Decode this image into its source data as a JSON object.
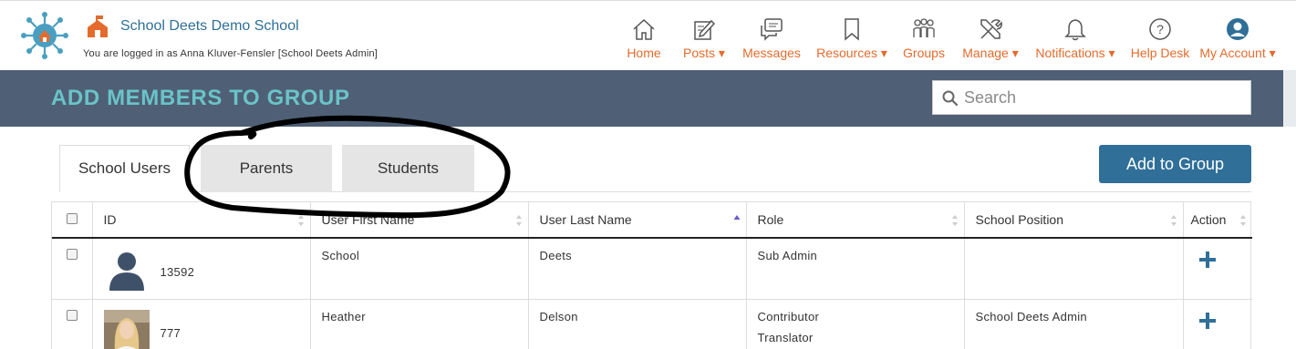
{
  "header": {
    "school_name": "School Deets Demo School",
    "logged_in_text": "You are logged in as Anna Kluver-Fensler [School Deets Admin]"
  },
  "nav": [
    {
      "label": "Home",
      "icon": "home-icon"
    },
    {
      "label": "Posts ▾",
      "icon": "edit-icon"
    },
    {
      "label": "Messages",
      "icon": "chat-icon"
    },
    {
      "label": "Resources ▾",
      "icon": "bookmark-icon"
    },
    {
      "label": "Groups",
      "icon": "people-icon"
    },
    {
      "label": "Manage ▾",
      "icon": "tools-icon"
    },
    {
      "label": "Notifications ▾",
      "icon": "bell-icon"
    },
    {
      "label": "Help Desk",
      "icon": "question-icon"
    },
    {
      "label": "My Account ▾",
      "icon": "user-icon"
    }
  ],
  "page_title": "ADD MEMBERS TO GROUP",
  "search": {
    "placeholder": "Search",
    "value": ""
  },
  "tabs": [
    {
      "label": "School Users",
      "active": true
    },
    {
      "label": "Parents",
      "active": false
    },
    {
      "label": "Students",
      "active": false
    }
  ],
  "add_button_label": "Add to Group",
  "table": {
    "columns": [
      "ID",
      "User First Name",
      "User Last Name",
      "Role",
      "School Position",
      "Action"
    ],
    "rows": [
      {
        "id": "13592",
        "first": "School",
        "last": "Deets",
        "role": [
          "Sub Admin"
        ],
        "position": "",
        "avatar": "default-avatar"
      },
      {
        "id": "777",
        "first": "Heather",
        "last": "Delson",
        "role": [
          "Contributor",
          "Translator"
        ],
        "position": "School Deets Admin",
        "avatar": "photo-avatar"
      }
    ]
  },
  "colors": {
    "accent_orange": "#e46b2c",
    "brand_blue": "#2f6f98",
    "header_band": "#4f5f75",
    "title_teal": "#69c4c7"
  }
}
